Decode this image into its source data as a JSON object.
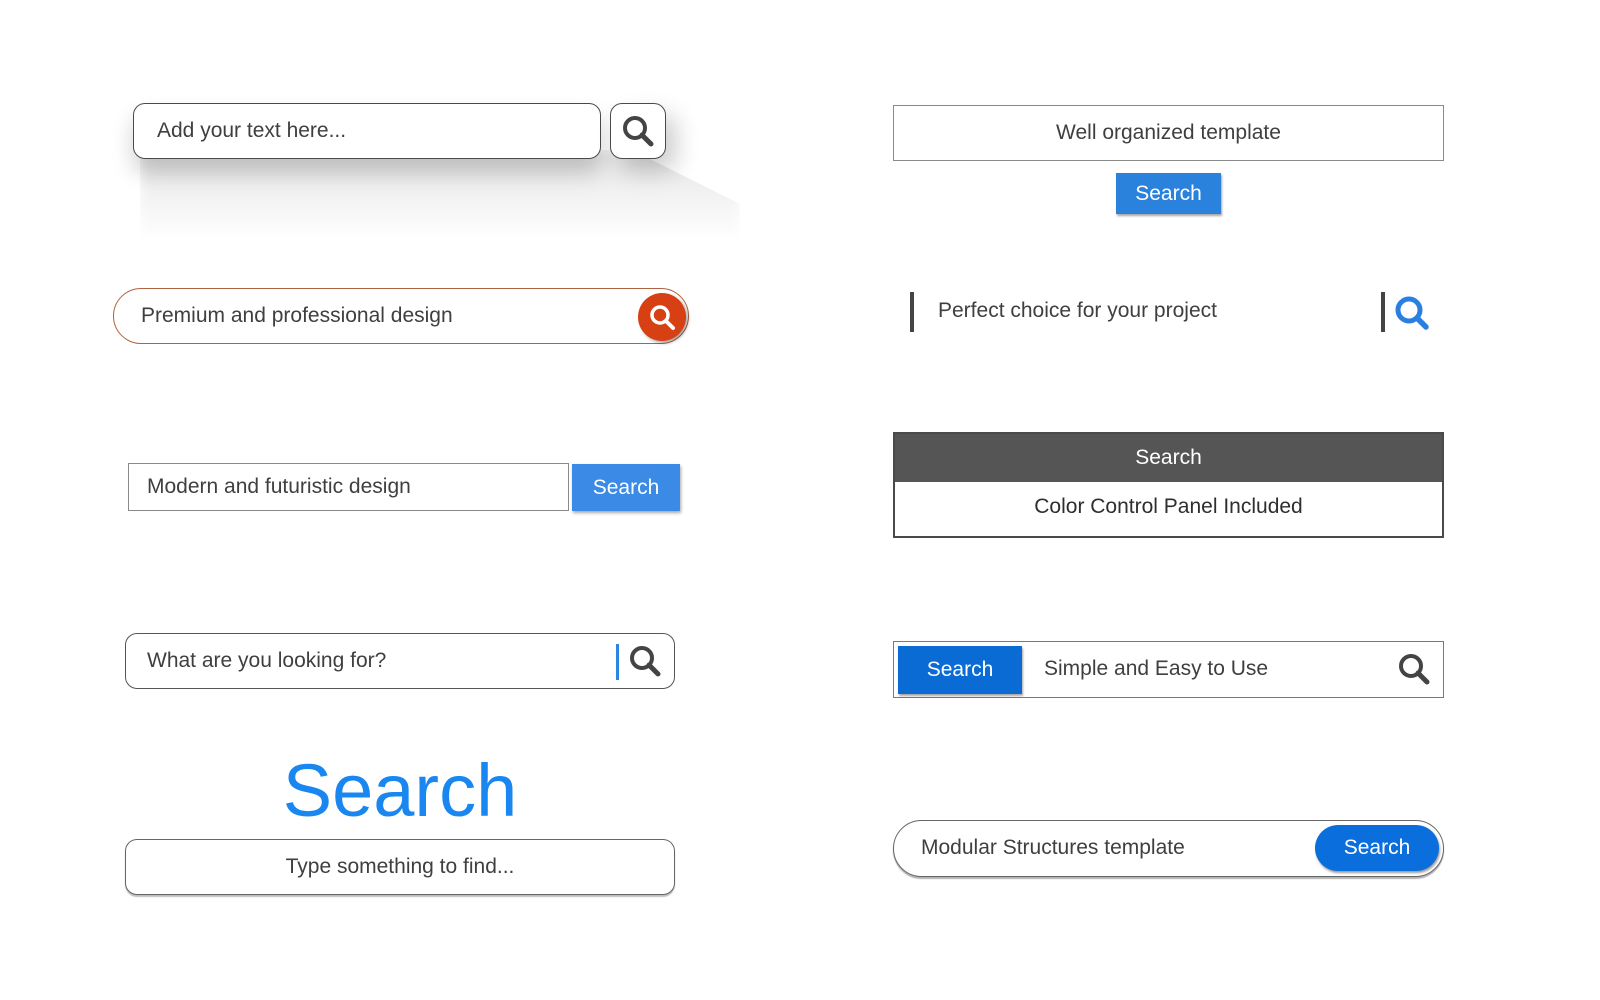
{
  "colors": {
    "orange_accent": "#d64012",
    "blue_primary": "#3a8ae6",
    "blue_dark": "#0a6bd4",
    "heading_blue": "#1a87f0",
    "panel_header": "#555555"
  },
  "left_column": {
    "shadow_search": {
      "placeholder": "Add your text here...",
      "icon": "search-icon"
    },
    "orange_pill_search": {
      "value": "Premium and professional design",
      "icon": "search-icon"
    },
    "square_search": {
      "value": "Modern and futuristic design",
      "button_label": "Search"
    },
    "divider_search": {
      "placeholder": "What are you looking for?",
      "icon": "search-icon"
    },
    "titled_search": {
      "title": "Search",
      "placeholder": "Type something to find..."
    }
  },
  "right_column": {
    "centered_search": {
      "value": "Well organized template",
      "button_label": "Search"
    },
    "bar_search": {
      "value": "Perfect choice for your project",
      "icon": "search-icon"
    },
    "panel_search": {
      "header_label": "Search",
      "value": "Color Control Panel Included"
    },
    "framed_search": {
      "button_label": "Search",
      "value": "Simple and Easy to Use",
      "icon": "search-icon"
    },
    "pill_search": {
      "value": "Modular Structures template",
      "button_label": "Search"
    }
  }
}
